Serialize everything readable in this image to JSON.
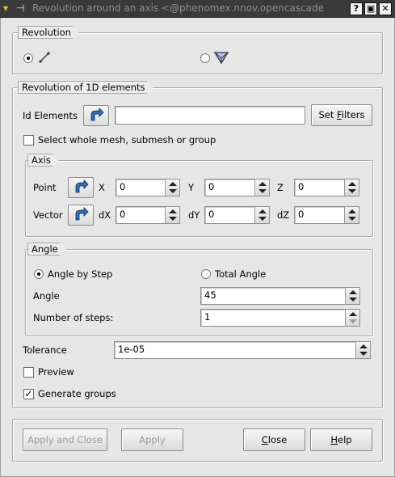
{
  "window": {
    "title": "Revolution around an axis <@phenomex.nnov.opencascade",
    "help_btn": "?",
    "maximize_btn": "▣",
    "close_btn": "✕"
  },
  "revolution": {
    "label": "Revolution"
  },
  "elements_1d": {
    "label": "Revolution of 1D elements",
    "id_elements_label": "Id Elements",
    "id_elements_value": "",
    "set_filters_pre": "Set ",
    "set_filters_mn": "F",
    "set_filters_post": "ilters",
    "select_whole_label": "Select whole mesh, submesh or group"
  },
  "axis": {
    "label": "Axis",
    "point_label": "Point",
    "vector_label": "Vector",
    "x_label": "X",
    "y_label": "Y",
    "z_label": "Z",
    "dx_label": "dX",
    "dy_label": "dY",
    "dz_label": "dZ",
    "x": "0",
    "y": "0",
    "z": "0",
    "dx": "0",
    "dy": "0",
    "dz": "0"
  },
  "angle": {
    "label": "Angle",
    "by_step_label": "Angle by Step",
    "total_label": "Total Angle",
    "angle_label": "Angle",
    "angle_value": "45",
    "steps_label": "Number of steps:",
    "steps_value": "1"
  },
  "tolerance": {
    "label": "Tolerance",
    "value": "1e-05"
  },
  "options": {
    "preview_label": "Preview",
    "generate_groups_label": "Generate groups"
  },
  "buttons": {
    "apply_close": "Apply and Close",
    "apply": "Apply",
    "close_mn": "C",
    "close_rest": "lose",
    "help_mn": "H",
    "help_rest": "elp"
  }
}
